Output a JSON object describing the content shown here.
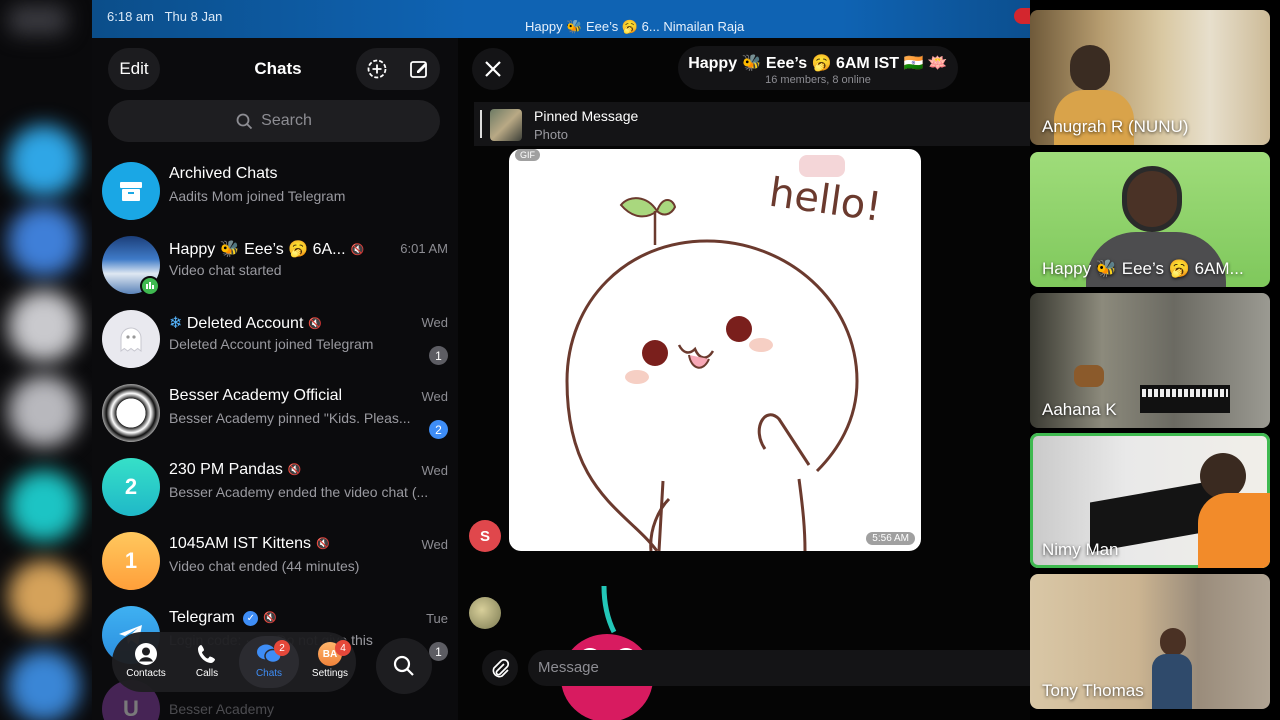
{
  "status_bar": {
    "time": "6:18 am",
    "date": "Thu 8 Jan",
    "active_call": "Happy 🐝 Eee’s 🥱 6...  Nimailan Raja"
  },
  "chat_list": {
    "edit_label": "Edit",
    "title": "Chats",
    "search_placeholder": "Search",
    "items": [
      {
        "name": "Archived Chats",
        "preview": "Aadits Mom joined Telegram",
        "date": "",
        "badge": "",
        "muted": false,
        "avatar_color": "#1aa7e5"
      },
      {
        "name": "Happy 🐝 Eee’s 🥱 6A...",
        "preview": "Video chat started",
        "date": "6:01 AM",
        "badge": "",
        "muted": true,
        "avatar_color": "#3a6fb0"
      },
      {
        "name": "Deleted Account",
        "prefix": "❄",
        "preview": "Deleted Account joined Telegram",
        "date": "Wed",
        "badge": "1",
        "muted": true,
        "avatar_color": "#e9e9ef"
      },
      {
        "name": "Besser Academy Official",
        "preview": "Besser Academy pinned \"Kids. Pleas...",
        "date": "Wed",
        "badge": "2",
        "muted": false,
        "avatar_color": "#ffffff"
      },
      {
        "name": "230 PM Pandas",
        "preview": "Besser Academy ended the video chat (...",
        "date": "Wed",
        "badge": "",
        "muted": true,
        "avatar_color": "#2fd4c3",
        "initial": "2"
      },
      {
        "name": "1045AM IST Kittens",
        "preview": "Video chat ended (44 minutes)",
        "date": "Wed",
        "badge": "",
        "muted": true,
        "avatar_color": "#ffb84d",
        "initial": "1"
      },
      {
        "name": "Telegram",
        "preview": "Login code: ·····. Do not give this",
        "date": "Tue",
        "badge": "1",
        "muted": true,
        "avatar_color": "#3aa0ea"
      },
      {
        "name": "",
        "preview": "Besser Academy",
        "date": "",
        "badge": "",
        "muted": false,
        "avatar_color": "#8e44ad",
        "initial": "U"
      }
    ]
  },
  "tabs": [
    {
      "label": "Contacts",
      "icon": "person-icon",
      "badge": ""
    },
    {
      "label": "Calls",
      "icon": "phone-icon",
      "badge": ""
    },
    {
      "label": "Chats",
      "icon": "chat-bubbles-icon",
      "badge": "2"
    },
    {
      "label": "Settings",
      "icon": "avatar-icon",
      "badge": "4",
      "avatar_initials": "BA"
    }
  ],
  "conversation": {
    "title": "Happy 🐝 Eee’s 🥱 6AM IST 🇮🇳 🪷",
    "subtitle": "16 members, 8 online",
    "pinned_title": "Pinned Message",
    "pinned_subtitle": "Photo",
    "gif_label": "GIF",
    "gif_text": "hello !",
    "gif_time": "5:56 AM",
    "sender_initial": "S",
    "message_placeholder": "Message"
  },
  "participants": [
    {
      "name": "Anugrah R (NUNU)",
      "speaking": false
    },
    {
      "name": "Happy 🐝 Eee’s 🥱 6AM...",
      "speaking": false
    },
    {
      "name": "Aahana K",
      "speaking": false
    },
    {
      "name": "Nimy Man",
      "speaking": true
    },
    {
      "name": "Tony Thomas",
      "speaking": false
    }
  ],
  "colors": {
    "accent": "#3e8df6",
    "status_bar": "#0f63b3",
    "badge_red": "#e5483a",
    "speaking_outline": "#3fb950"
  }
}
